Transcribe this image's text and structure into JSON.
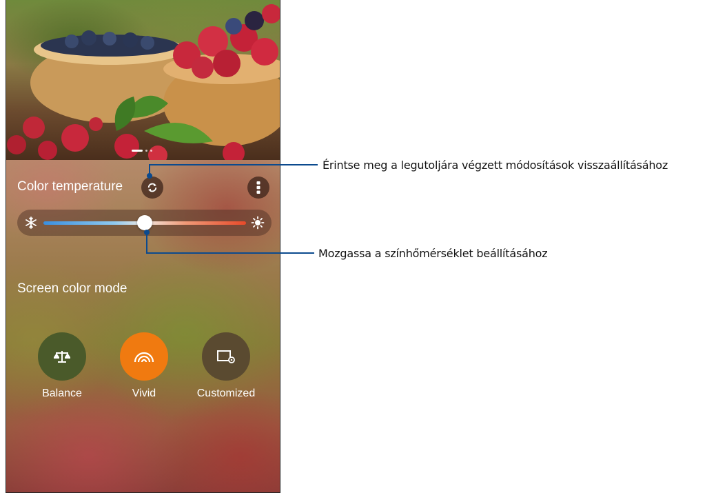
{
  "screen": {
    "color_temperature_label": "Color temperature",
    "screen_color_mode_label": "Screen color mode",
    "slider": {
      "value_fraction": 0.5,
      "min_icon": "snowflake-icon",
      "max_icon": "sun-icon"
    },
    "modes": [
      {
        "label": "Balance",
        "icon": "balance-scale-icon",
        "color": "#4a5a2a",
        "selected": false
      },
      {
        "label": "Vivid",
        "icon": "vivid-rainbow-icon",
        "color": "#f07a10",
        "selected": true
      },
      {
        "label": "Customized",
        "icon": "custom-display-icon",
        "color": "#5a4a30",
        "selected": false
      }
    ],
    "accent_color": "#f07a10"
  },
  "callouts": {
    "reset": "Érintse meg a legutoljára végzett módosítások visszaállításához",
    "slider": "Mozgassa a színhőmérséklet beállításához"
  }
}
